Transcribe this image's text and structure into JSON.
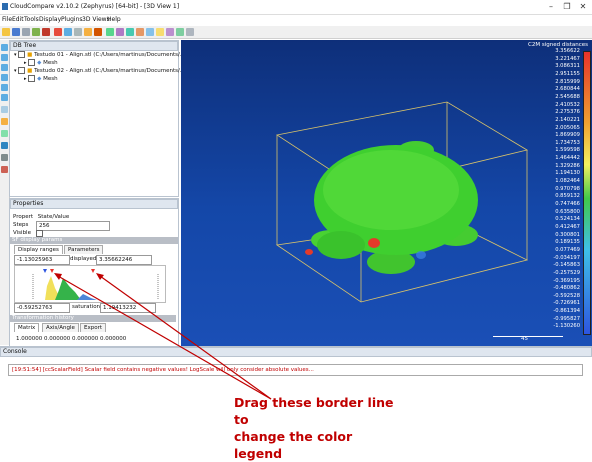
{
  "window": {
    "title": "CloudCompare v2.10.2 (Zephyrus) [64-bit] - [3D View 1]",
    "minimize": "–",
    "restore": "❐",
    "close": "✕"
  },
  "menu": [
    "File",
    "Edit",
    "Tools",
    "Display",
    "Plugins",
    "3D Views",
    "Help"
  ],
  "db_tree": {
    "header": "DB Tree",
    "items": [
      {
        "label": "Testudo 01 - Align.stl (C:/Users/martinus/Documents/...",
        "child": "Mesh"
      },
      {
        "label": "Testudo 02 - Align.stl (C:/Users/martinus/Documents/...",
        "child": "Mesh"
      }
    ]
  },
  "properties": {
    "header": "Properties",
    "col1": "Propert",
    "col2": "State/Value",
    "steps_label": "Steps",
    "steps_value": "256",
    "visible_label": "Visible",
    "sf_section": "SF display params",
    "tabs": [
      "Display ranges",
      "Parameters"
    ],
    "min_value": "-1.13025963",
    "displayed_label": "displayed",
    "max_value": "3.35662246",
    "low_value": "-0.59252763",
    "saturation_label": "saturation",
    "sat_value": "1.19413232",
    "transform_section": "Transformation history",
    "transform_tabs": [
      "Matrix",
      "Axis/Angle",
      "Export"
    ],
    "matrix_row": "1.000000 0.000000 0.000000 0.000000"
  },
  "view3d": {
    "legend_title": "C2M signed distances",
    "legend_values": [
      "3.356622",
      "3.221467",
      "3.086311",
      "2.951155",
      "2.815999",
      "2.680844",
      "2.545688",
      "2.410532",
      "2.275376",
      "2.140221",
      "2.005065",
      "1.869909",
      "1.734753",
      "1.599598",
      "1.464442",
      "1.329286",
      "1.194130",
      "1.082464",
      "0.970798",
      "0.859132",
      "0.747466",
      "0.635800",
      "0.524134",
      "0.412467",
      "0.300801",
      "0.189135",
      "0.077469",
      "-0.034197",
      "-0.145863",
      "-0.257529",
      "-0.369195",
      "-0.480862",
      "-0.592528",
      "-0.726961",
      "-0.861394",
      "-0.995827",
      "-1.130260"
    ],
    "scale_value": "45"
  },
  "console": {
    "header": "Console",
    "line": "[19:51:54] [ccScalarField] Scalar field contains negative values! LogScale will only consider absolute values..."
  },
  "annotation": {
    "line1": "Drag these border line to",
    "line2": "change the color legend",
    "color": "#c00000"
  },
  "colors": {
    "view_bg_top": "#0e2f7a",
    "view_bg_bottom": "#1a4fb6",
    "turtle_green": "#3fcf2f",
    "accent_red": "#c00000"
  }
}
